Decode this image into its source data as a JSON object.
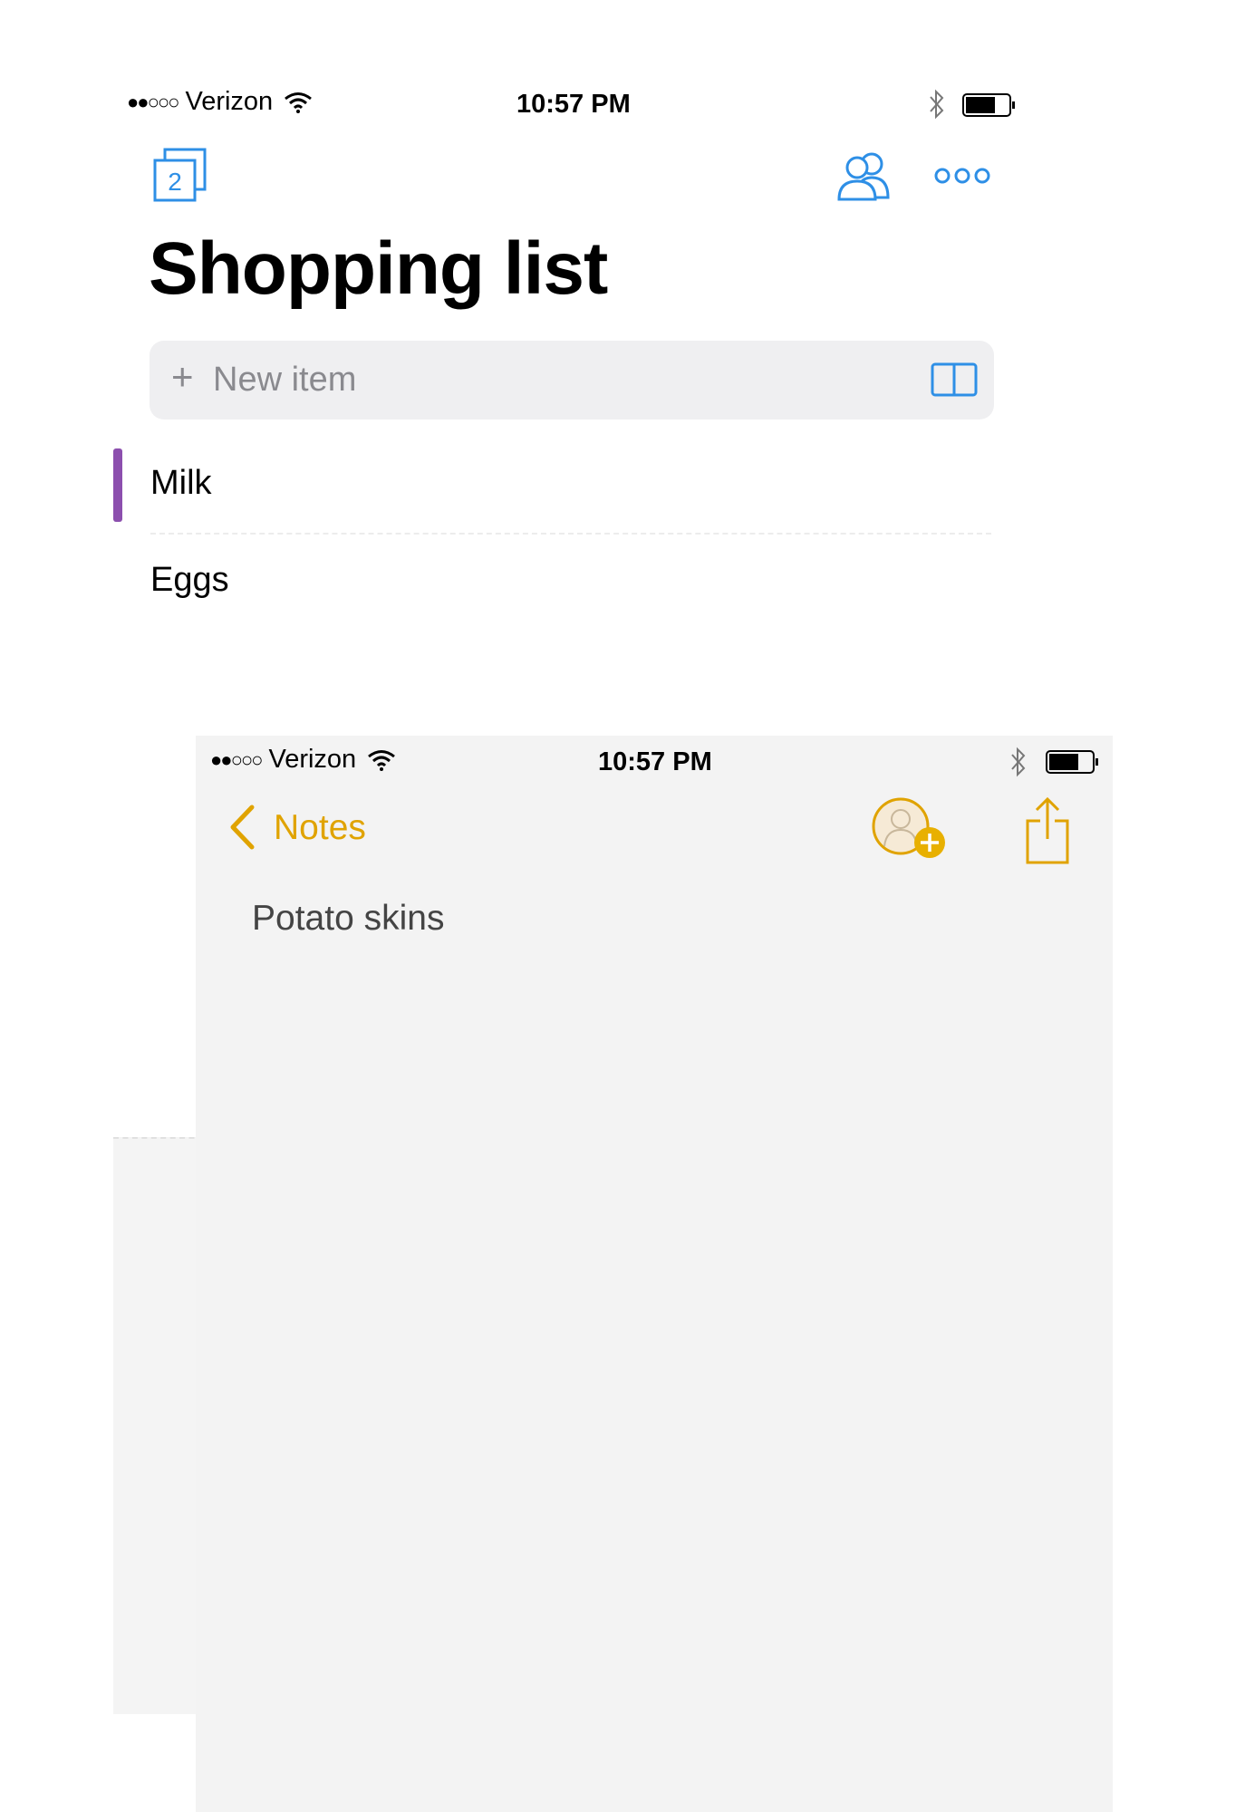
{
  "top_app": {
    "status_bar": {
      "signal": "●●○○○",
      "carrier": "Verizon",
      "time": "10:57 PM"
    },
    "toolbar": {
      "list_count": "2"
    },
    "list_title": "Shopping list",
    "new_item": {
      "plus": "+",
      "placeholder": "New item"
    },
    "items": [
      {
        "label": "Milk",
        "marker_color": "#8c4fae"
      },
      {
        "label": "Eggs"
      }
    ]
  },
  "notes_app": {
    "status_bar": {
      "signal": "●●○○○",
      "carrier": "Verizon",
      "time": "10:57 PM"
    },
    "nav": {
      "back_label": "Notes"
    },
    "note_body": "Potato skins"
  },
  "colors": {
    "accent_blue": "#2e8fe6",
    "notes_gold": "#e0a300",
    "list_marker": "#8c4fae"
  },
  "icons": [
    "wifi-icon",
    "bluetooth-icon",
    "battery-icon",
    "lists-stack-icon",
    "share-people-icon",
    "more-icon",
    "book-icon",
    "chevron-left-icon",
    "add-person-icon",
    "share-icon"
  ]
}
